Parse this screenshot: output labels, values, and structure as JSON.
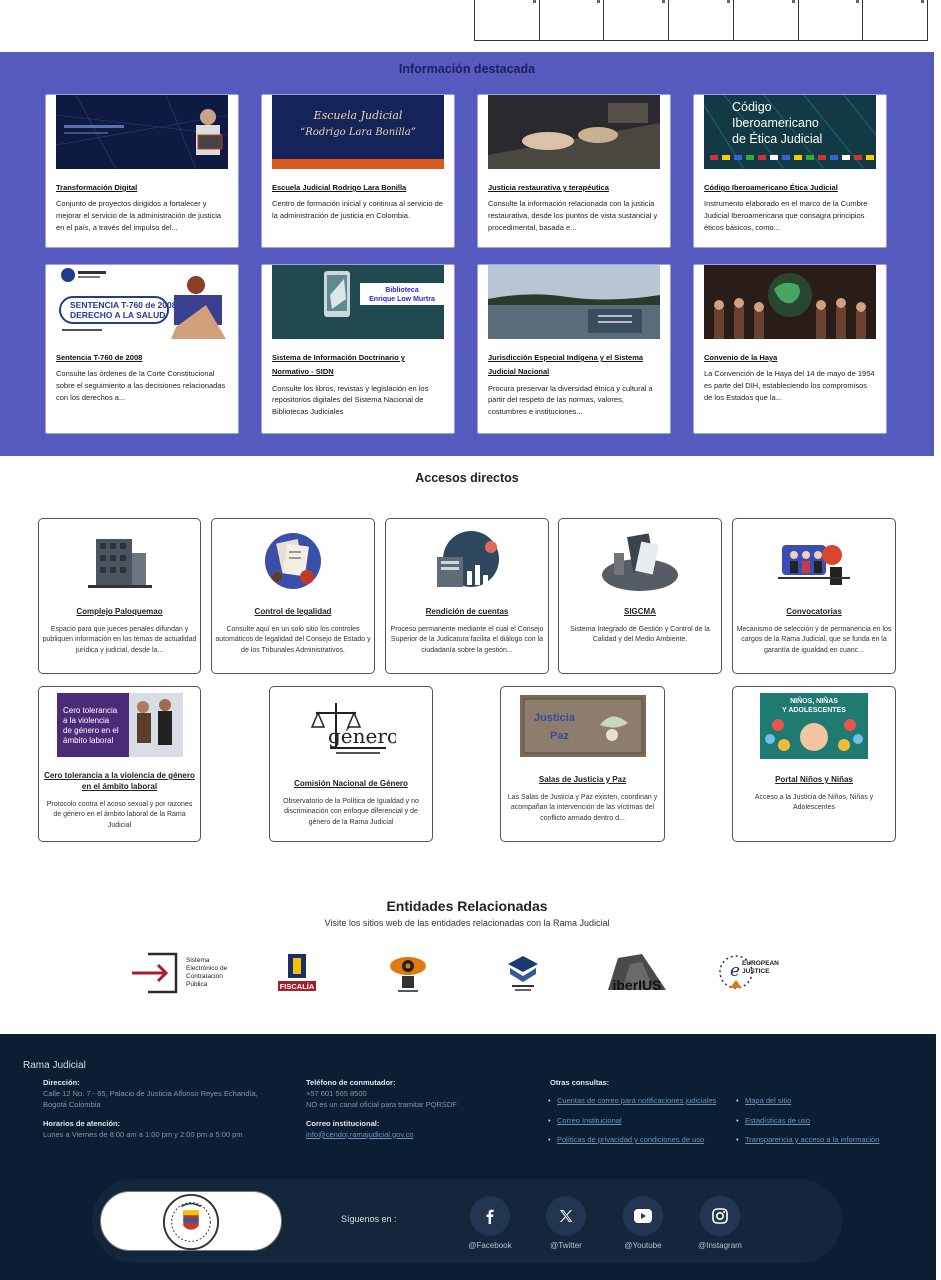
{
  "featured": {
    "title": "Información destacada",
    "cards": [
      {
        "title": "Transformación Digital",
        "text": "Conjunto de proyectos dirigidos a fortalecer y mejorar el servicio de la administración de justicia en el país, a través del impulso del..."
      },
      {
        "title": "Escuela Judicial Rodrigo Lara Bonilla",
        "text": "Centro de formación inicial y continua al servicio de la administración de justicia en Colombia.",
        "thumb_text": "Escuela Judicial \"Rodrigo Lara Bonilla\""
      },
      {
        "title": "Justicia restaurativa y terapéutica",
        "text": "Consulte la información relacionada con la justicia restaurativa, desde los puntos de vista sustancial y procedimental, basada e..."
      },
      {
        "title": "Código Iberoamericano Ética Judicial",
        "text": "Instrumento elaborado en el marco de la Cumbre Judicial Iberoamericana que consagra principios éticos básicos, como...",
        "thumb_text": [
          "Código",
          "Iberoamericano",
          "de Ética Judicial"
        ]
      },
      {
        "title": "Sentencia T-760 de 2008",
        "text": "Consulte las órdenes de la Corte Constitucional sobre el seguimiento a las decisiones relacionadas con los derechos a...",
        "thumb_text": [
          "SENTENCIA T-760 de 2008",
          "DERECHO A LA SALUD"
        ]
      },
      {
        "title": "Sistema de Información Doctrinario y Normativo - SIDN",
        "text": "Consulte los libros, revistas y legislación en los repositorios digitales del Sistema Nacional de Bibliotecas Judiciales",
        "thumb_text": [
          "Biblioteca",
          "Enrique Low Murtra"
        ]
      },
      {
        "title": "Jurisdicción Especial Indígena y el Sistema Judicial Nacional",
        "text": "Procura preservar la diversidad étnica y cultural a partir del respeto de las normas, valores, costumbres e instituciones..."
      },
      {
        "title": "Convenio de la Haya",
        "text": "La Convención de la Haya del 14 de mayo de 1954 es parte del DIH, estableciendo los compromisos de los Estados que la..."
      }
    ]
  },
  "access": {
    "title": "Accesos directos",
    "items": [
      {
        "title": "Complejo Paloquemao",
        "desc": "Espacio para que jueces penales difundan y publiquen información en los temas de actualidad jurídica y judicial, desde la..."
      },
      {
        "title": "Control de legalidad",
        "desc": "Consulte aquí en un solo sitio los controles automáticos de legalidad del Consejo de Estado y de los Tribunales Administrativos."
      },
      {
        "title": "Rendición de cuentas",
        "desc": "Proceso permanente mediante el cual el Consejo Superior de la Judicatura facilita el diálogo con la ciudadanía sobre la gestión..."
      },
      {
        "title": "SIGCMA",
        "desc": "Sistema Integrado de Gestión y Control de la Calidad y del Medio Ambiente."
      },
      {
        "title": "Convocatorias",
        "desc": "Mecanismo de selección y de permanencia en los cargos de la Rama Judicial, que se funda en la garantía de igualdad en cuanc..."
      },
      {
        "title": "Cero tolerancia a la violencia de género en el ámbito laboral",
        "desc": "Protocolo contra el acoso sexual y por razones de género en el ámbito laboral de la Rama Judicial",
        "thumb_text": [
          "Cero tolerancia",
          "a la violencia",
          "de género en el",
          "ámbito laboral"
        ]
      },
      {
        "title": "Comisión Nacional de Género",
        "desc": "Observatorio de la Política de Igualdad y no discriminación con enfoque diferencial y de género de la Rama Judicial",
        "thumb_text": "género"
      },
      {
        "title": "Salas de Justicia y Paz",
        "desc": "Las Salas de Justicia y Paz existen, coordinan y acompañan la intervención de las víctimas del conflicto armado dentro d...",
        "thumb_text": [
          "Justicia",
          "Paz"
        ]
      },
      {
        "title": "Portal Niños y Niñas",
        "desc": "Acceso a la Justicia de Niños, Niñas y Adolescentes",
        "thumb_text": [
          "NIÑOS, NIÑAS",
          "Y ADOLESCENTES"
        ]
      }
    ]
  },
  "related": {
    "title": "Entidades Relacionadas",
    "subtitle": "Visite los sitios web de las entidades relacionadas con la Rama Judicial",
    "logos": [
      {
        "name": "secop",
        "text": [
          "Sistema",
          "Electrónico de",
          "Contratación",
          "Pública"
        ]
      },
      {
        "name": "fiscalia",
        "text": "FISCALÍA"
      },
      {
        "name": "inpec",
        "text": ""
      },
      {
        "name": "defensoria",
        "text": ""
      },
      {
        "name": "iberius",
        "text": "iberIUS"
      },
      {
        "name": "european-justice",
        "text": [
          "EUROPEAN",
          "JUSTICE"
        ]
      }
    ]
  },
  "footer": {
    "brand": "Rama Judicial",
    "address_label": "Dirección:",
    "address": "Calle 12 No. 7 - 65, Palacio de Justicia Alfonso Reyes Echandía, Bogotá Colombia",
    "hours_label": "Horarios de atención:",
    "hours": "Lunes a Viernes de 8:00 am a 1:00 pm y 2:00 pm a 5:00 pm",
    "phone_label": "Teléfono de conmutador:",
    "phone": "+57 601 565 8500",
    "phone_note": "NO es un canal oficial para tramitar PQRSDF",
    "email_label": "Correo institucional:",
    "email": "info@cendoj.ramajudicial.gov.co",
    "other_label": "Otras consultas:",
    "links_left": [
      "Cuentas de correo para notificaciones judiciales",
      "Correo Institucional",
      "Políticas de privacidad y condiciones de uso"
    ],
    "links_right": [
      "Mapa del sitio",
      "Estadísticas de uso",
      "Transparencia y acceso a la información"
    ],
    "follow": "Síguenos en :",
    "social": [
      "@Facebook",
      "@Twitter",
      "@Youtube",
      "@Instagram"
    ]
  },
  "colors": {
    "band": "#5659bd",
    "footer": "#0b1e33",
    "footer_bar": "#14263b",
    "link": "#6f93b8"
  }
}
